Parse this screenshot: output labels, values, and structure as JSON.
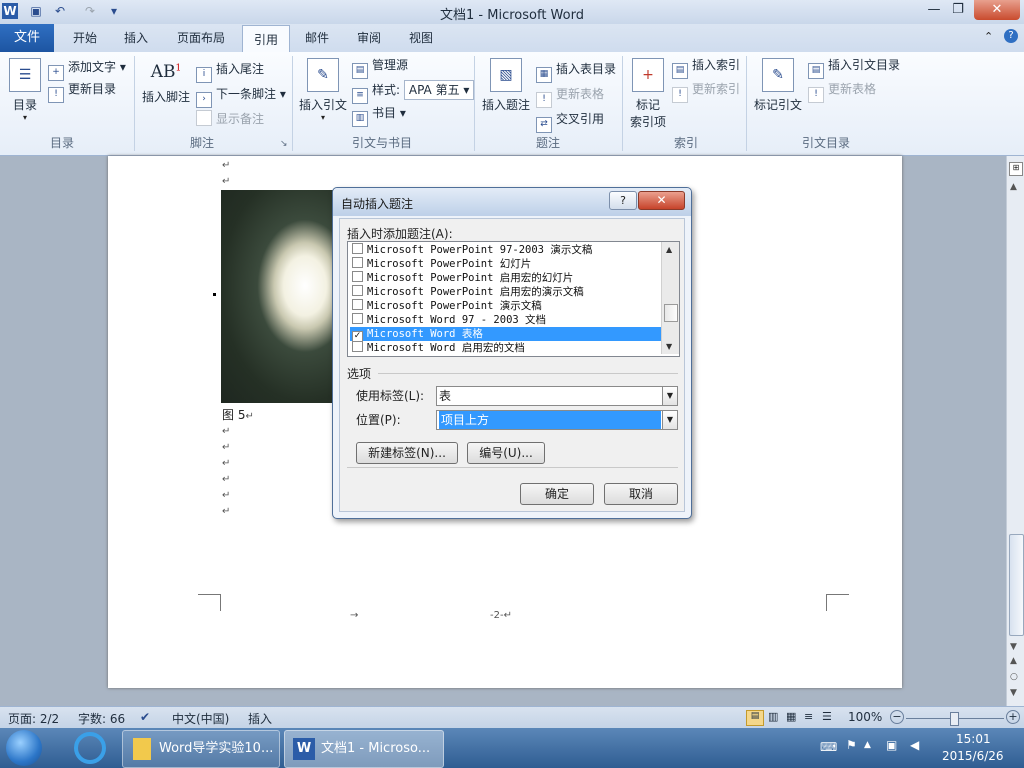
{
  "window": {
    "title": "文档1 - Microsoft Word",
    "qat_icons": [
      "word-app-icon",
      "save-icon",
      "undo-icon",
      "redo-icon",
      "customize-qat-icon"
    ],
    "controls": {
      "minimize": "—",
      "maximize": "❐",
      "close": "✕"
    }
  },
  "ribbon_tabs": [
    "文件",
    "开始",
    "插入",
    "页面布局",
    "引用",
    "邮件",
    "审阅",
    "视图"
  ],
  "active_tab": "引用",
  "ribbon": {
    "toc": {
      "big": "目录",
      "add_text": "添加文字",
      "update_toc": "更新目录",
      "group": "目录"
    },
    "footnotes": {
      "big": "插入脚注",
      "insert_endnote": "插入尾注",
      "next_footnote": "下一条脚注",
      "show_notes": "显示备注",
      "group": "脚注"
    },
    "citations": {
      "big": "插入引文",
      "manage_sources": "管理源",
      "style_label": "样式:",
      "style_value": "APA 第五",
      "bibliography": "书目",
      "group": "引文与书目"
    },
    "captions": {
      "big": "插入题注",
      "insert_table_of_figures": "插入表目录",
      "update_table": "更新表格",
      "cross_reference": "交叉引用",
      "group": "题注"
    },
    "index": {
      "big_line1": "标记",
      "big_line2": "索引项",
      "insert_index": "插入索引",
      "update_index": "更新索引",
      "group": "索引"
    },
    "toa": {
      "big": "标记引文",
      "insert_toa": "插入引文目录",
      "update_table": "更新表格",
      "group": "引文目录"
    }
  },
  "document": {
    "caption": "图 5",
    "para_mark": "↵",
    "tab_mark": "→",
    "page_number": "-2-↵"
  },
  "dialog": {
    "title": "自动插入题注",
    "help": "?",
    "close": "✕",
    "list_label": "插入时添加题注(A):",
    "items": [
      {
        "text": "Microsoft PowerPoint 97-2003 演示文稿",
        "checked": false,
        "selected": false
      },
      {
        "text": "Microsoft PowerPoint 幻灯片",
        "checked": false,
        "selected": false
      },
      {
        "text": "Microsoft PowerPoint 启用宏的幻灯片",
        "checked": false,
        "selected": false
      },
      {
        "text": "Microsoft PowerPoint 启用宏的演示文稿",
        "checked": false,
        "selected": false
      },
      {
        "text": "Microsoft PowerPoint 演示文稿",
        "checked": false,
        "selected": false
      },
      {
        "text": "Microsoft Word 97 - 2003 文档",
        "checked": false,
        "selected": false
      },
      {
        "text": "Microsoft Word 表格",
        "checked": true,
        "selected": true
      },
      {
        "text": "Microsoft Word 启用宏的文档",
        "checked": false,
        "selected": false
      }
    ],
    "options_label": "选项",
    "use_label_label": "使用标签(L):",
    "use_label_value": "表",
    "position_label": "位置(P):",
    "position_value": "项目上方",
    "new_label_button": "新建标签(N)...",
    "numbering_button": "编号(U)...",
    "ok_button": "确定",
    "cancel_button": "取消",
    "check_mark": "✓"
  },
  "statusbar": {
    "page": "页面: 2/2",
    "words": "字数: 66",
    "language": "中文(中国)",
    "mode": "插入",
    "zoom": "100%",
    "zoom_out": "−",
    "zoom_in": "+"
  },
  "taskbar": {
    "items": [
      "Word导学实验10...",
      "文档1 - Microso..."
    ],
    "time": "15:01",
    "date": "2015/6/26"
  }
}
